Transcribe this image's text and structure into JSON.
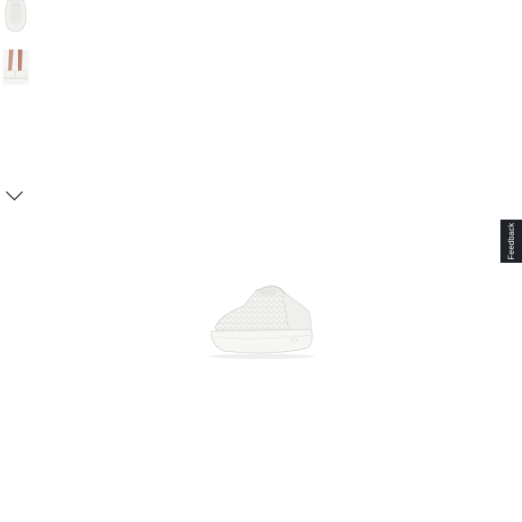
{
  "thumbnails": [
    {
      "alt": "",
      "view": "top"
    },
    {
      "alt": "",
      "view": "on-foot"
    }
  ],
  "navigation": {
    "next_icon": "chevron-down-icon"
  },
  "product_image": {
    "view": "heel-angle",
    "color": "#f2f2f0"
  },
  "feedback": {
    "label": "Feedback",
    "bg_color": "#1f2327"
  }
}
